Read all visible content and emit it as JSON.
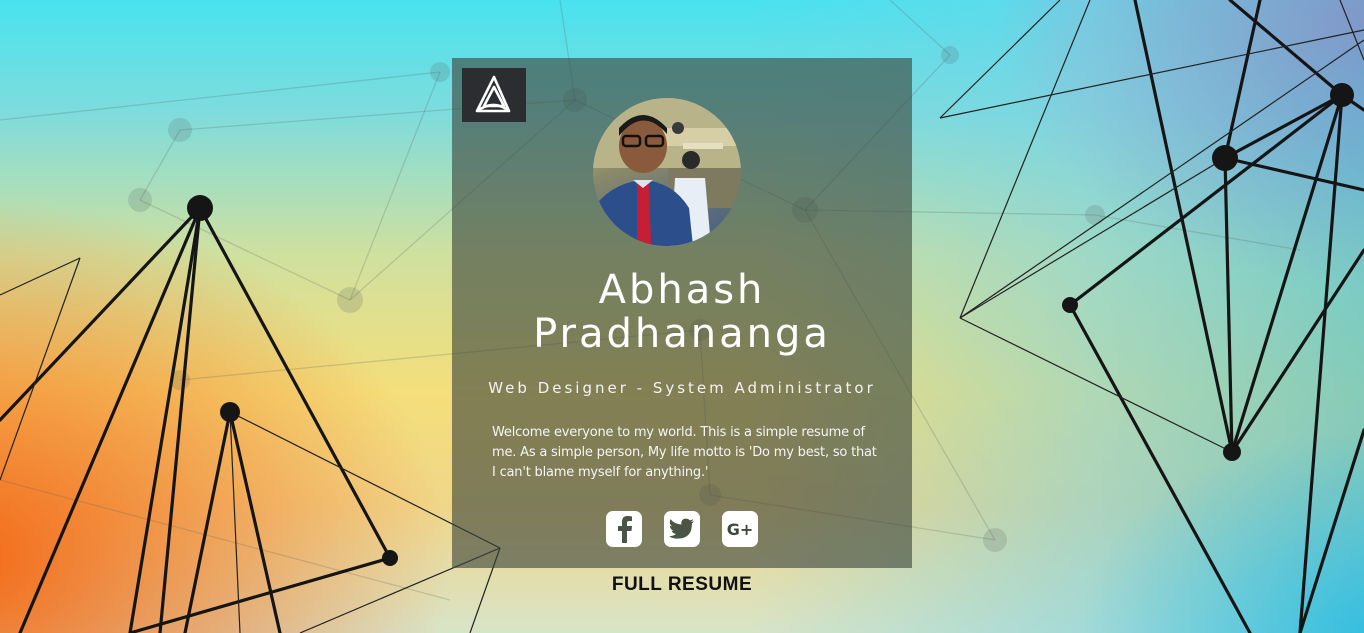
{
  "page": {
    "background": {
      "top_color": "#48e2ef",
      "middle_color": "#f4df7a",
      "left_color": "#f46814",
      "top_right_color": "#ec5aa0",
      "bottom_right_color": "#26bee0"
    }
  },
  "profile": {
    "logo_icon": "triangle-knot-logo-icon",
    "avatar_alt": "profile photo",
    "name": "Abhash Pradhananga",
    "name_line1": "Abhash",
    "name_line2": "Pradhananga",
    "role": "Web Designer - System Administrator",
    "bio": "Welcome everyone to my world. This is a simple resume of me. As a simple person, My life motto is 'Do my best, so that I can't blame myself for anything.'",
    "social_links": [
      {
        "id": "facebook",
        "icon": "facebook-icon",
        "glyph": "f"
      },
      {
        "id": "twitter",
        "icon": "twitter-icon",
        "glyph": ""
      },
      {
        "id": "google-plus",
        "icon": "google-plus-icon",
        "glyph": "G+"
      }
    ],
    "cta": "FULL RESUME"
  }
}
